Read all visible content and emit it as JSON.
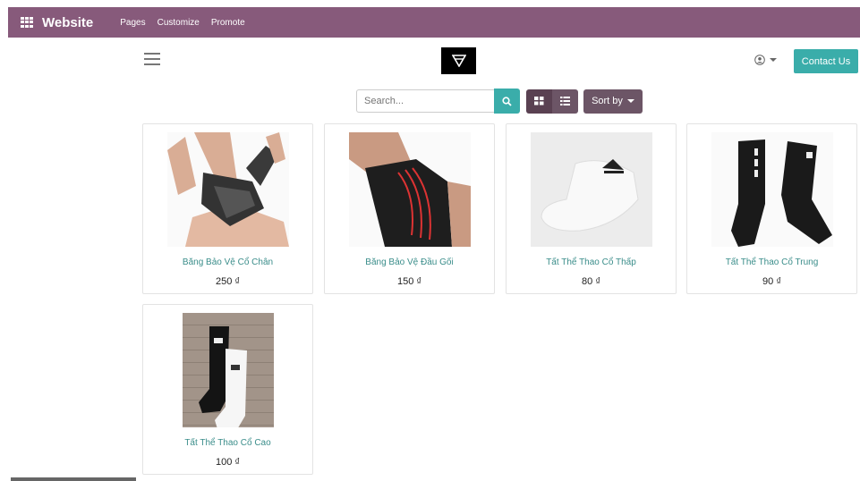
{
  "navbar": {
    "brand": "Website",
    "menu": [
      "Pages",
      "Customize",
      "Promote"
    ]
  },
  "header": {
    "contact_label": "Contact Us"
  },
  "toolbar": {
    "search_placeholder": "Search...",
    "sort_label": "Sort by"
  },
  "products": [
    {
      "name": "Băng Bảo Vệ Cổ Chân",
      "price": "250 ₫"
    },
    {
      "name": "Băng Bảo Vệ Đầu Gối",
      "price": "150 ₫"
    },
    {
      "name": "Tất Thể Thao Cổ Thấp",
      "price": "80 ₫"
    },
    {
      "name": "Tất Thể Thao Cổ Trung",
      "price": "90 ₫"
    },
    {
      "name": "Tất Thể Thao Cổ Cao",
      "price": "100 ₫"
    }
  ],
  "colors": {
    "navbar": "#875a7b",
    "accent": "#3aadaa",
    "secondary": "#6c5566",
    "product_name": "#3a8d8a"
  },
  "icons": [
    "apps-icon",
    "hamburger-icon",
    "user-icon",
    "search-icon",
    "grid-view-icon",
    "list-view-icon"
  ]
}
